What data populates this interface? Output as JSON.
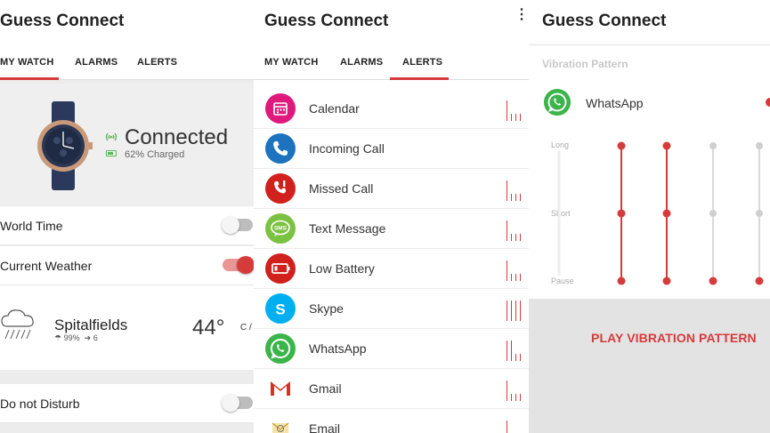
{
  "app_title": "Guess Connect",
  "tabs": {
    "my_watch": "MY WATCH",
    "alarms": "ALARMS",
    "alerts": "ALERTS"
  },
  "my_watch": {
    "status": "Connected",
    "charge": "62% Charged",
    "world_time": {
      "label": "World Time",
      "on": false
    },
    "current_weather": {
      "label": "Current Weather",
      "on": true
    },
    "weather": {
      "city": "Spitalfields",
      "humidity": "99%",
      "wind": "6",
      "temperature": "44°",
      "unit": "C /"
    },
    "do_not_disturb": {
      "label": "Do not Disturb",
      "on": false
    }
  },
  "alerts": [
    {
      "label": "Calendar",
      "icon": "calendar-icon",
      "color": "#e0197d"
    },
    {
      "label": "Incoming Call",
      "icon": "phone-icon",
      "color": "#1e73be"
    },
    {
      "label": "Missed Call",
      "icon": "missed-call-icon",
      "color": "#d0211c"
    },
    {
      "label": "Text Message",
      "icon": "sms-icon",
      "color": "#7cc242"
    },
    {
      "label": "Low Battery",
      "icon": "battery-icon",
      "color": "#d0211c"
    },
    {
      "label": "Skype",
      "icon": "skype-icon",
      "color": "#00aff0"
    },
    {
      "label": "WhatsApp",
      "icon": "whatsapp-icon",
      "color": "#3bb44a"
    },
    {
      "label": "Gmail",
      "icon": "gmail-icon",
      "color": "#d93025"
    },
    {
      "label": "Email",
      "icon": "email-icon",
      "color": "#f2c14e"
    }
  ],
  "vibration": {
    "title": "Vibration Pattern",
    "app": "WhatsApp",
    "levels": {
      "long": "Long",
      "short": "Short",
      "pause": "Pause"
    },
    "play_label": "PLAY VIBRATION PATTERN",
    "colors": {
      "active": "#d63b3b",
      "inactive": "#cfcfcf"
    }
  }
}
